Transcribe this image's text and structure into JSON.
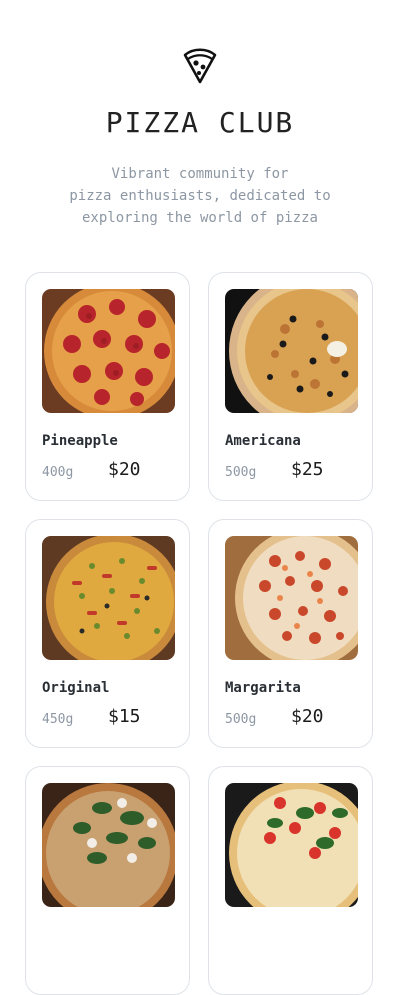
{
  "header": {
    "logo_icon": "pizza-slice-icon",
    "title": "PIZZA CLUB",
    "subtitle_lines": [
      "Vibrant community for",
      "pizza enthusiasts, dedicated to",
      "exploring the world of pizza"
    ]
  },
  "products": [
    {
      "name": "Pineapple",
      "weight": "400g",
      "price": "$20"
    },
    {
      "name": "Americana",
      "weight": "500g",
      "price": "$25"
    },
    {
      "name": "Original",
      "weight": "450g",
      "price": "$15"
    },
    {
      "name": "Margarita",
      "weight": "500g",
      "price": "$20"
    },
    {
      "name": "",
      "weight": "",
      "price": ""
    },
    {
      "name": "",
      "weight": "",
      "price": ""
    }
  ],
  "colors": {
    "card_border": "#dfe3e8",
    "muted_text": "#8d97a3",
    "title_text": "#222222"
  }
}
